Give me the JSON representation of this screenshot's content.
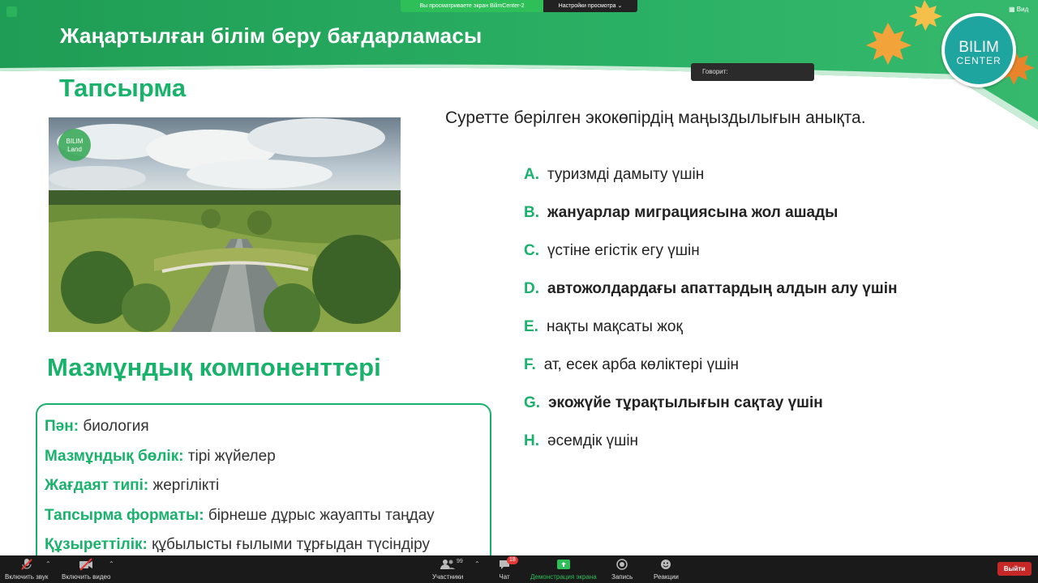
{
  "slide": {
    "title": "Жаңартылған білім беру бағдарламасы",
    "logo": {
      "line1": "BILIM",
      "line2": "CENTER"
    },
    "task_title": "Тапсырма",
    "photo_badge": {
      "line1": "BILIM",
      "line2": "Land"
    },
    "question": "Суретте берілген экокөпірдің маңыздылығын анықта.",
    "options": [
      {
        "letter": "A.",
        "text": "туризмді дамыту үшін",
        "bold": false
      },
      {
        "letter": "B.",
        "text": "жануарлар миграциясына жол ашады",
        "bold": true
      },
      {
        "letter": "C.",
        "text": "үстіне егістік егу үшін",
        "bold": false
      },
      {
        "letter": "D.",
        "text": " автожолдардағы апаттардың алдын алу үшін",
        "bold": true
      },
      {
        "letter": "E.",
        "text": "нақты мақсаты жоқ",
        "bold": false
      },
      {
        "letter": "F.",
        "text": " ат, есек арба көліктері үшін",
        "bold": false
      },
      {
        "letter": "G.",
        "text": " экожүйе тұрақтылығын сақтау үшін",
        "bold": true
      },
      {
        "letter": "H.",
        "text": "әсемдік үшін",
        "bold": false
      }
    ],
    "content_title": "Мазмұндық компоненттері",
    "content_rows": [
      {
        "key": "Пән:",
        "value": "биология"
      },
      {
        "key": "Мазмұндық бөлік:",
        "value": "тірі жүйелер"
      },
      {
        "key": "Жағдаят типі:",
        "value": "жергілікті"
      },
      {
        "key": "Тапсырма форматы:",
        "value": "бірнеше дұрыс жауапты таңдау"
      },
      {
        "key": "Құзыреттілік:",
        "value": "құбылысты ғылыми тұрғыдан түсіндіру"
      }
    ]
  },
  "zoom": {
    "share_banner": "Вы просматриваете экран BilimCenter-2",
    "view_settings": "Настройки просмотра ⌄",
    "view_button": "Вид",
    "speaking_label": "Говорит:",
    "toolbar": {
      "mute": "Включить звук",
      "video": "Включить видео",
      "participants": "Участники",
      "participants_count": "99",
      "chat": "Чат",
      "chat_count": "18",
      "share": "Демонстрация экрана",
      "record": "Запись",
      "reactions": "Реакции",
      "leave": "Выйти"
    }
  },
  "colors": {
    "accent_green": "#19b26b",
    "header_green": "#23a85a",
    "logo_teal": "#1fa59f",
    "leave_red": "#c62828"
  }
}
